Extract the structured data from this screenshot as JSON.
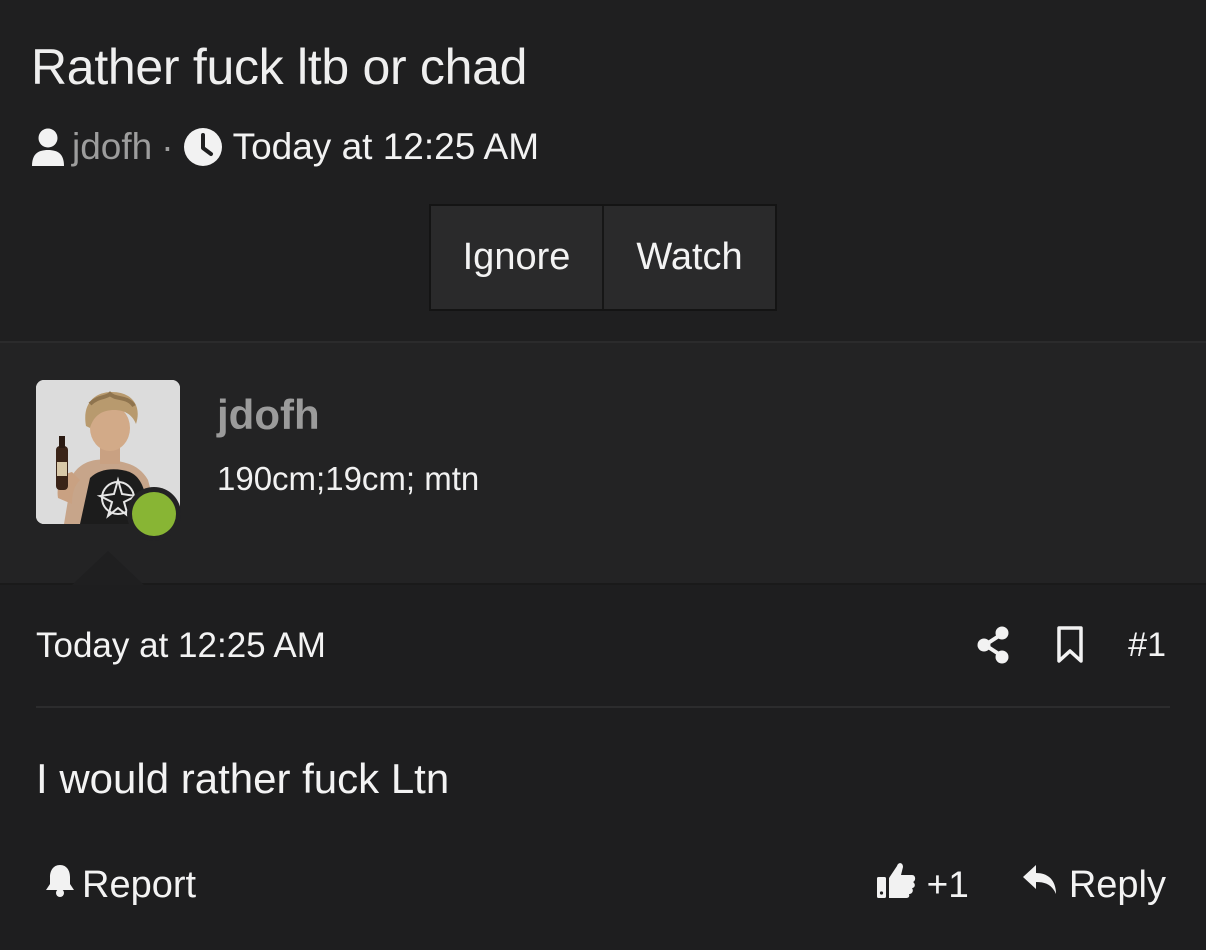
{
  "thread": {
    "title": "Rather fuck ltb or chad",
    "author": "jdofh",
    "separator": "·",
    "date": "Today at 12:25 AM",
    "buttons": {
      "ignore": "Ignore",
      "watch": "Watch"
    }
  },
  "post": {
    "user": {
      "name": "jdofh",
      "title": "190cm;19cm; mtn",
      "online_color": "#88b534"
    },
    "date": "Today at 12:25 AM",
    "number": "#1",
    "body": "I would rather fuck Ltn",
    "footer": {
      "report": "Report",
      "likes": "+1",
      "reply": "Reply"
    }
  },
  "icons": {
    "user": "user-icon",
    "clock": "clock-icon",
    "share": "share-icon",
    "bookmark": "bookmark-icon",
    "bell": "bell-icon",
    "like": "thumbs-up-icon",
    "reply": "reply-icon"
  }
}
